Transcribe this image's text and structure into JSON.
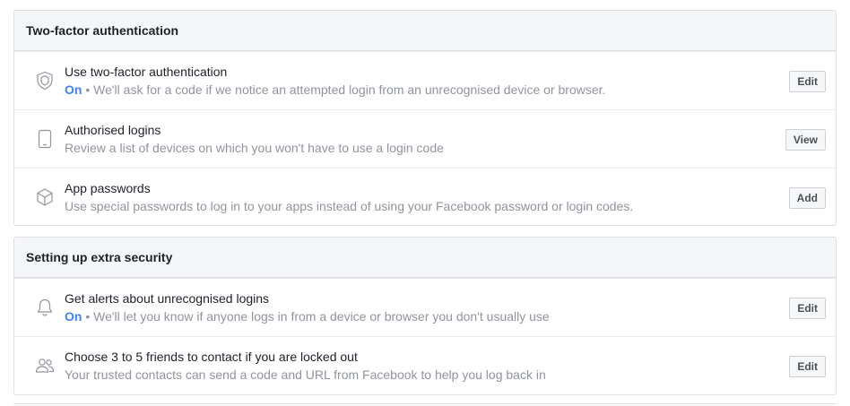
{
  "sections": [
    {
      "title": "Two-factor authentication",
      "rows": [
        {
          "icon": "shield-icon",
          "title": "Use two-factor authentication",
          "status": "On",
          "description": " • We'll ask for a code if we notice an attempted login from an unrecognised device or browser.",
          "button": "Edit"
        },
        {
          "icon": "phone-icon",
          "title": "Authorised logins",
          "description": "Review a list of devices on which you won't have to use a login code",
          "button": "View"
        },
        {
          "icon": "cube-icon",
          "title": "App passwords",
          "description": "Use special passwords to log in to your apps instead of using your Facebook password or login codes.",
          "button": "Add"
        }
      ]
    },
    {
      "title": "Setting up extra security",
      "rows": [
        {
          "icon": "bell-icon",
          "title": "Get alerts about unrecognised logins",
          "status": "On",
          "description": " • We'll let you know if anyone logs in from a device or browser you don't usually use",
          "button": "Edit"
        },
        {
          "icon": "friends-icon",
          "title": "Choose 3 to 5 friends to contact if you are locked out",
          "description": "Your trusted contacts can send a code and URL from Facebook to help you log back in",
          "button": "Edit"
        }
      ]
    }
  ],
  "colors": {
    "status_on": "#4080ff",
    "description": "#90949c",
    "header_bg": "#f5f6f7",
    "border": "#dddfe2"
  }
}
